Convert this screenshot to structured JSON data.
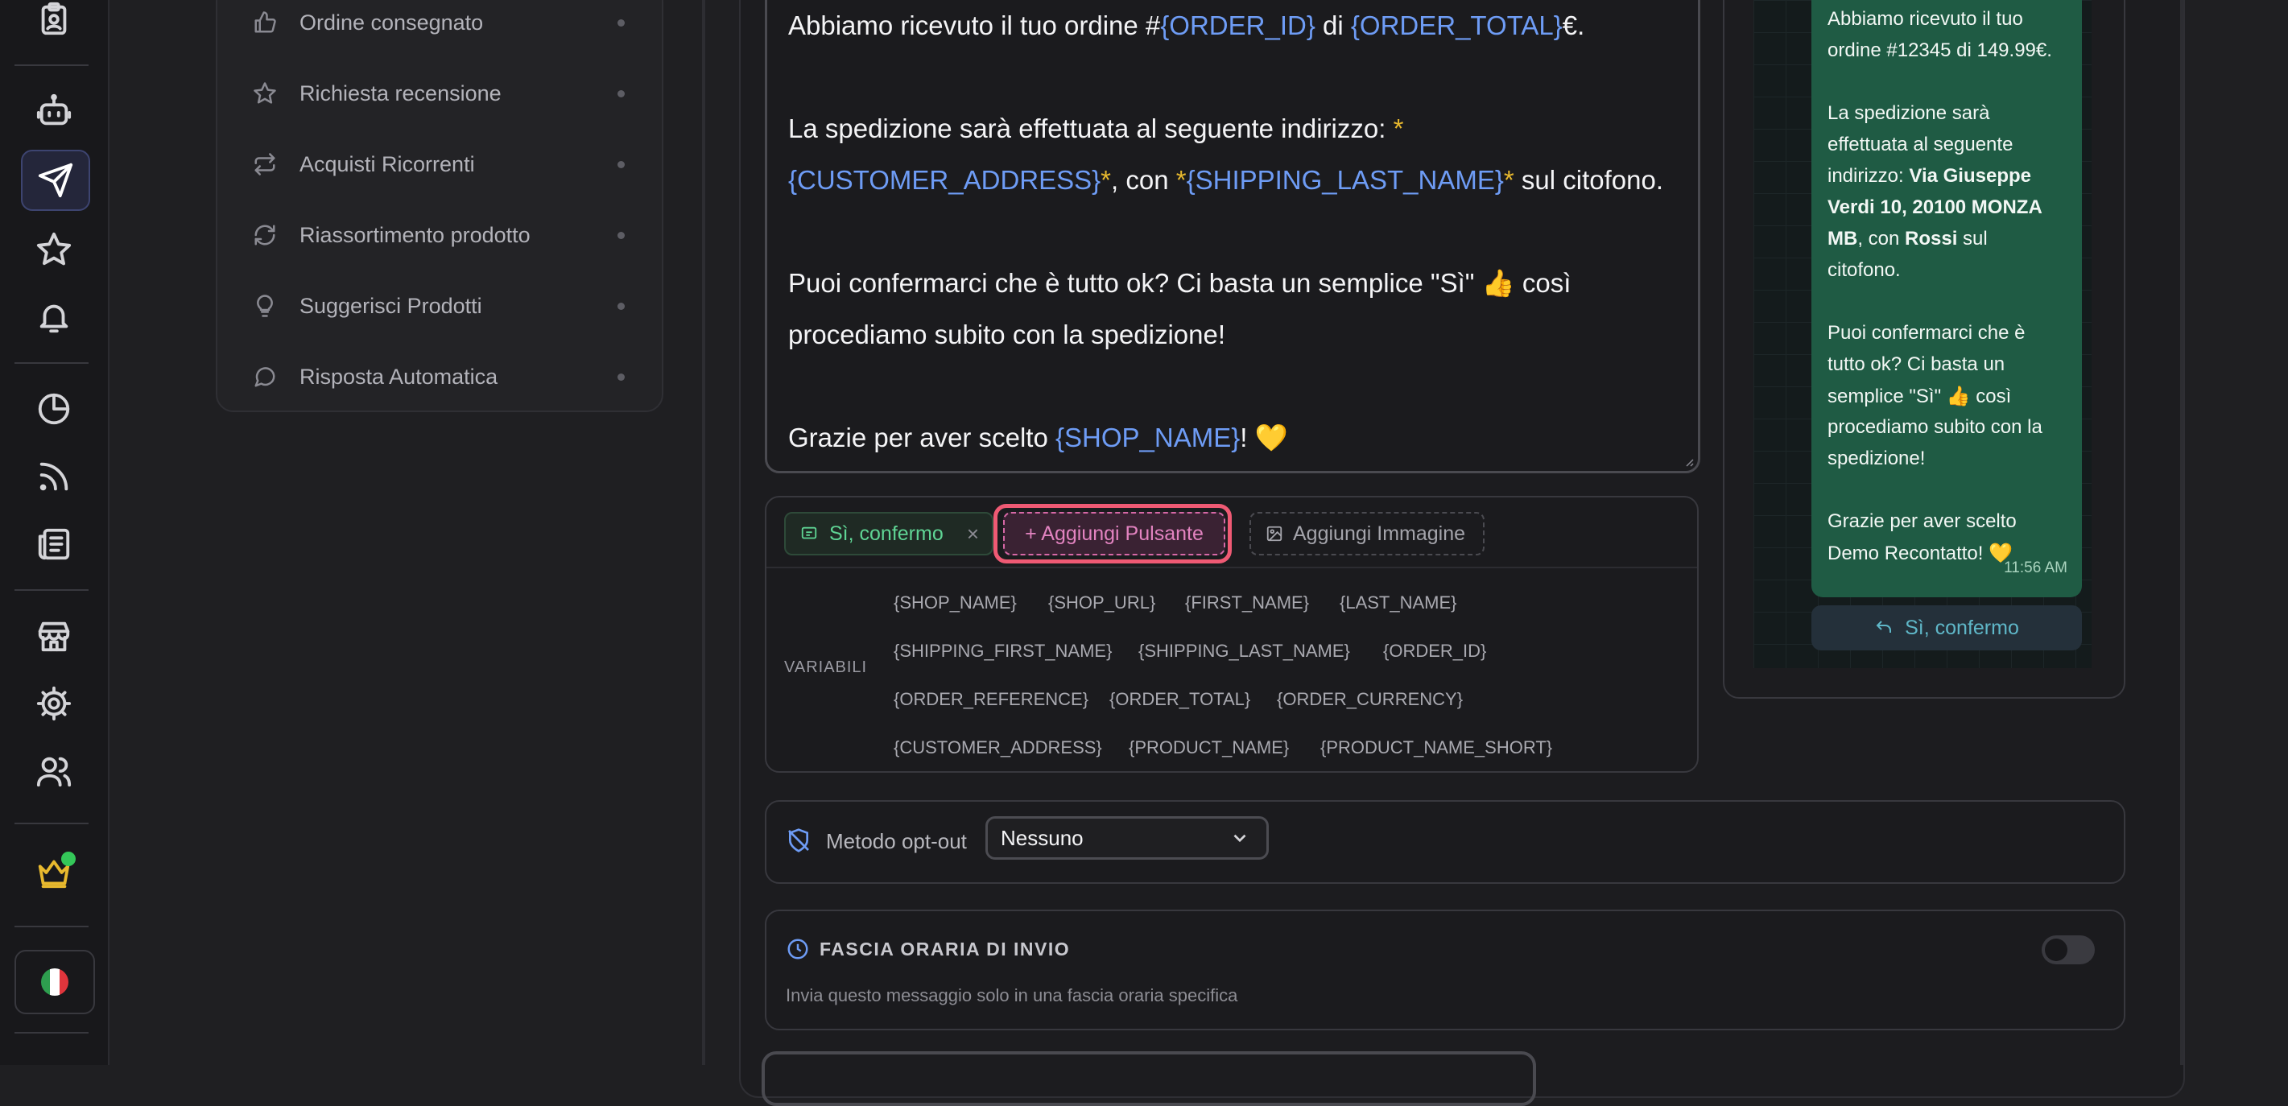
{
  "nav": {
    "items": [
      {
        "label": "Ordine consegnato",
        "icon": "thumbs-up-icon"
      },
      {
        "label": "Richiesta recensione",
        "icon": "star-icon"
      },
      {
        "label": "Acquisti Ricorrenti",
        "icon": "repeat-icon"
      },
      {
        "label": "Riassortimento prodotto",
        "icon": "refresh-icon"
      },
      {
        "label": "Suggerisci Prodotti",
        "icon": "lightbulb-icon"
      },
      {
        "label": "Risposta Automatica",
        "icon": "chat-bubble-icon"
      }
    ]
  },
  "rail": {
    "icons": [
      "clipboard-icon",
      "robot-icon",
      "send-icon",
      "star-icon",
      "bell-icon",
      "pie-chart-icon",
      "rss-icon",
      "newspaper-icon",
      "store-icon",
      "settings-gear-icon",
      "users-icon",
      "crown-icon",
      "italy-flag-icon"
    ],
    "active": "send-icon"
  },
  "message": {
    "line1": {
      "t1": "Abbiamo ricevuto il tuo ordine #",
      "v1": "{ORDER_ID}",
      "t2": " di ",
      "v2": "{ORDER_TOTAL}",
      "t3": "€."
    },
    "line2": {
      "t1": "La spedizione sarà effettuata al seguente indirizzo: ",
      "s1": "*"
    },
    "line3": {
      "v1": "{CUSTOMER_ADDRESS}",
      "s1": "*",
      "t1": ", con ",
      "s2": "*",
      "v2": "{SHIPPING_LAST_NAME}",
      "s3": "*",
      "t2": " sul citofono."
    },
    "line4": "Puoi confermarci che è tutto ok? Ci basta un semplice \"Sì\" 👍 così",
    "line5": "procediamo subito con la spedizione!",
    "line6": {
      "t1": "Grazie per aver scelto ",
      "v1": "{SHOP_NAME}",
      "t2": "! 💛"
    }
  },
  "toolbar": {
    "chip_label": "Sì, confermo",
    "chip_remove": "×",
    "add_button": "+ Aggiungi Pulsante",
    "add_image": "Aggiungi Immagine"
  },
  "variables": {
    "label": "VARIABILI",
    "rows": [
      [
        "{SHOP_NAME}",
        "{SHOP_URL}",
        "{FIRST_NAME}",
        "{LAST_NAME}"
      ],
      [
        "{SHIPPING_FIRST_NAME}",
        "{SHIPPING_LAST_NAME}",
        "{ORDER_ID}"
      ],
      [
        "{ORDER_REFERENCE}",
        "{ORDER_TOTAL}",
        "{ORDER_CURRENCY}"
      ],
      [
        "{CUSTOMER_ADDRESS}",
        "{PRODUCT_NAME}",
        "{PRODUCT_NAME_SHORT}"
      ]
    ]
  },
  "preview": {
    "lines": [
      "Abbiamo ricevuto il tuo",
      "ordine #12345 di 149.99€.",
      "",
      "La spedizione sarà",
      "effettuata al seguente",
      "indirizzo: ",
      "Verdi 10, 20100 MONZA",
      "MB",
      "citofono.",
      "",
      "Puoi confermarci che è",
      "tutto ok? Ci basta un",
      "semplice \"Sì\" 👍 così",
      "procediamo subito con la",
      "spedizione!",
      "",
      "Grazie per aver scelto",
      "Demo Recontatto! 💛"
    ],
    "bold_address_part": "Via Giuseppe",
    "line8_rest": ", con ",
    "line8_bold": "Rossi",
    "line8_end": " sul",
    "time": "11:56 AM",
    "reply_button": "Sì, confermo"
  },
  "optout": {
    "label": "Metodo opt-out",
    "selected": "Nessuno"
  },
  "fascia": {
    "title": "FASCIA ORARIA DI INVIO",
    "description": "Invia questo messaggio solo in una fascia oraria specifica",
    "enabled": false
  },
  "colors": {
    "accent_blue": "#6e9cf5",
    "variable_yellow": "#e8b92e",
    "chip_green": "#5fd494",
    "add_pink": "#e283c0",
    "highlight_red": "#ef5a74",
    "bubble_green": "#1f5b44"
  }
}
